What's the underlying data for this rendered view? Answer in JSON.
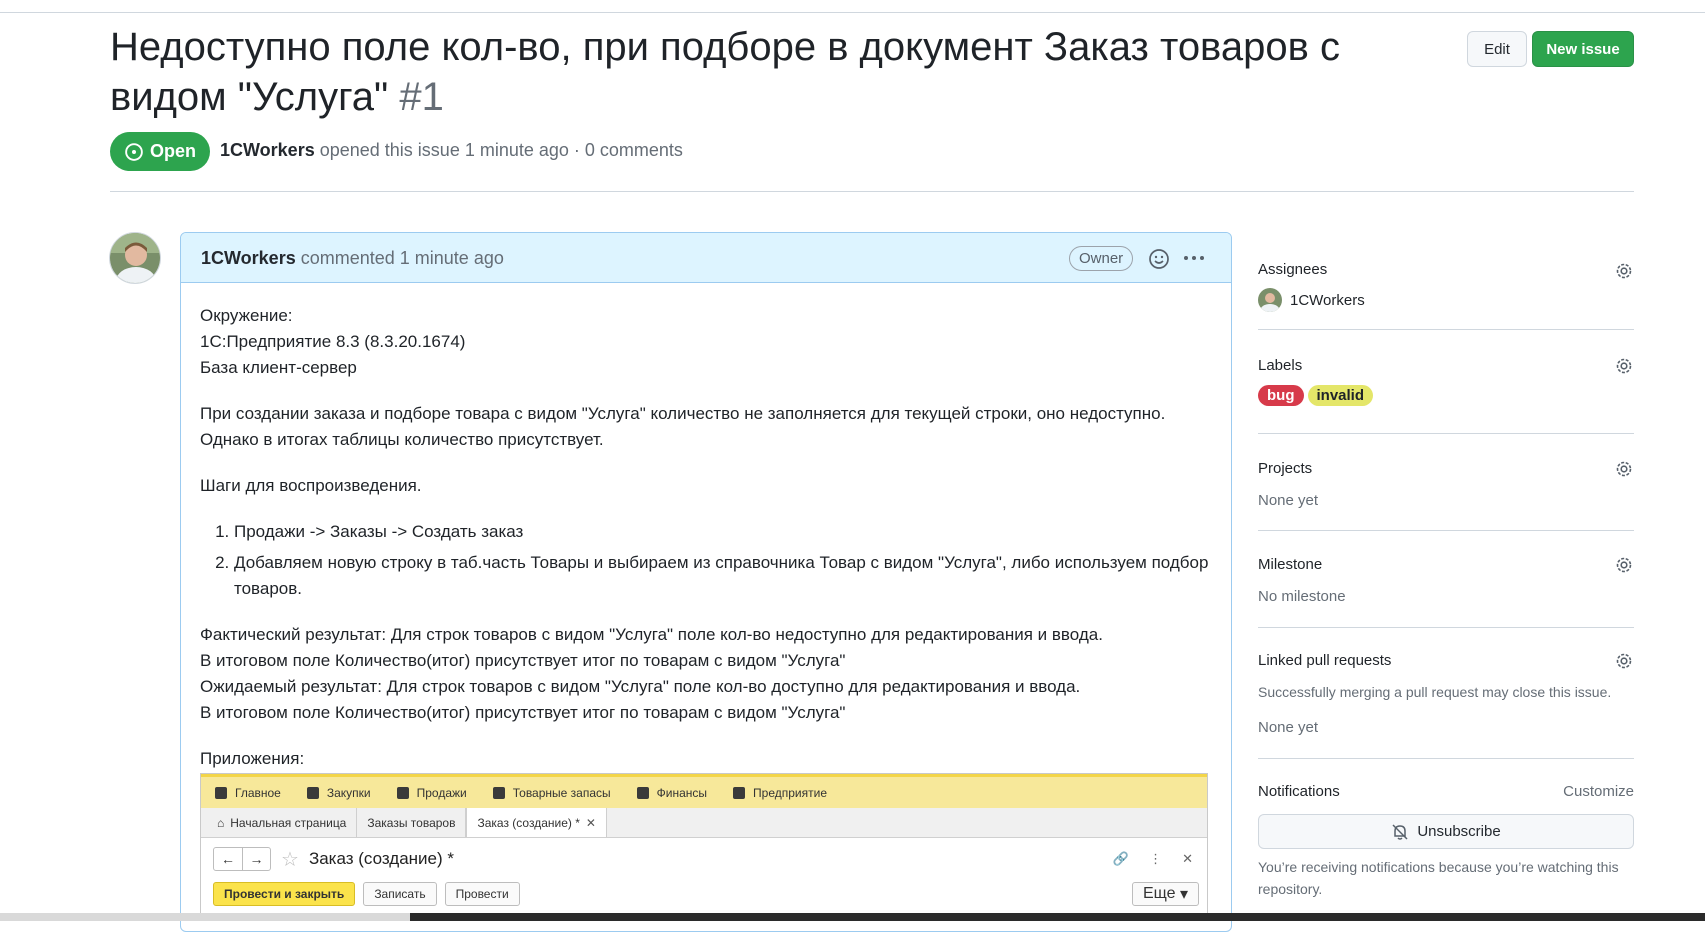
{
  "issue": {
    "title": "Недоступно поле кол-во, при подборе в документ Заказ товаров с видом \"Услуга\"",
    "number": "#1",
    "state": "Open",
    "author": "1CWorkers",
    "opened_text": "opened this issue 1 minute ago · 0 comments"
  },
  "header_buttons": {
    "edit": "Edit",
    "new_issue": "New issue"
  },
  "comment": {
    "author": "1CWorkers",
    "time_text": "commented 1 minute ago",
    "role_badge": "Owner",
    "env_lines": [
      "Окружение:",
      "1С:Предприятие 8.3 (8.3.20.1674)",
      "База клиент-сервер"
    ],
    "para1_lines": [
      "При создании заказа и подборе товара с видом \"Услуга\" количество не заполняется для текущей строки, оно недоступно.",
      "Однако в итогах таблицы количество присутствует."
    ],
    "steps_heading": "Шаги для воспроизведения.",
    "steps": [
      "Продажи -> Заказы -> Создать заказ",
      "Добавляем новую строку в таб.часть Товары и выбираем из справочника Товар с видом \"Услуга\", либо используем подбор товаров."
    ],
    "result_lines": [
      "Фактический результат: Для строк товаров с видом \"Услуга\" поле кол-во недоступно для редактирования и ввода.",
      "В итоговом поле Количество(итог) присутствует итог по товарам с видом \"Услуга\"",
      "Ожидаемый результат: Для строк товаров с видом \"Услуга\" поле кол-во доступно для редактирования и ввода.",
      "В итоговом поле Количество(итог) присутствует итог по товарам с видом \"Услуга\""
    ],
    "attachments_label": "Приложения:"
  },
  "screenshot": {
    "menu": [
      "Главное",
      "Закупки",
      "Продажи",
      "Товарные запасы",
      "Финансы",
      "Предприятие"
    ],
    "tabs": [
      "Начальная страница",
      "Заказы товаров",
      "Заказ (создание) *"
    ],
    "form_title": "Заказ (создание) *",
    "buttons": [
      "Провести и закрыть",
      "Записать",
      "Провести"
    ],
    "more": "Еще"
  },
  "sidebar": {
    "assignees": {
      "heading": "Assignees",
      "user": "1CWorkers"
    },
    "labels": {
      "heading": "Labels",
      "items": [
        "bug",
        "invalid"
      ],
      "colors": [
        "#d73a4a",
        "#e4e669"
      ]
    },
    "projects": {
      "heading": "Projects",
      "value": "None yet"
    },
    "milestone": {
      "heading": "Milestone",
      "value": "No milestone"
    },
    "linked_prs": {
      "heading": "Linked pull requests",
      "hint": "Successfully merging a pull request may close this issue.",
      "value": "None yet"
    },
    "notifications": {
      "heading": "Notifications",
      "customize": "Customize",
      "button": "Unsubscribe",
      "note": "You’re receiving notifications because you’re watching this repository."
    }
  }
}
